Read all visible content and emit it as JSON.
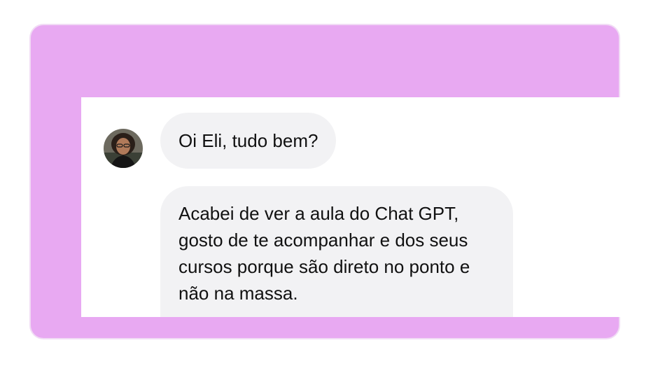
{
  "frame": {
    "background_color": "#e8a9f2",
    "card_color": "#ffffff",
    "bubble_color": "#f2f2f4"
  },
  "messages": [
    {
      "avatar_icon": "person-avatar-icon",
      "lines": [
        "Oi Eli, tudo bem?"
      ]
    },
    {
      "lines": [
        "Acabei de ver a aula do Chat GPT,",
        "gosto de te acompanhar e dos seus",
        "cursos porque são direto no ponto e",
        "não na massa."
      ]
    }
  ]
}
